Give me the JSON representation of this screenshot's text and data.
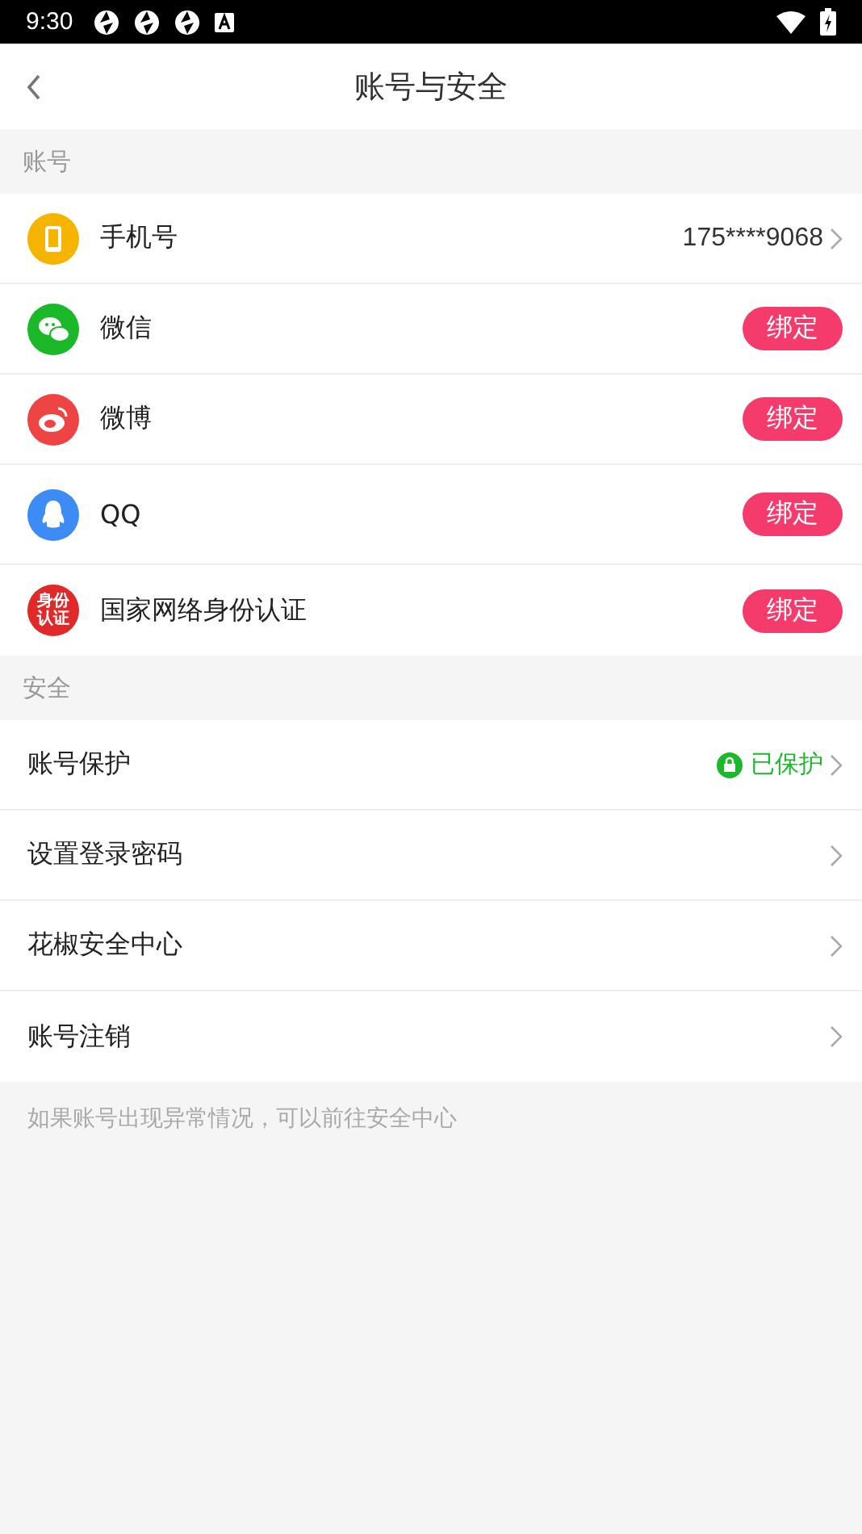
{
  "status_bar": {
    "time": "9:30"
  },
  "header": {
    "title": "账号与安全"
  },
  "sections": [
    {
      "title": "账号",
      "rows": [
        {
          "kind": "phone",
          "label": "手机号",
          "value": "175****9068",
          "chevron": true
        },
        {
          "kind": "wechat",
          "label": "微信",
          "button": "绑定",
          "chevron": false
        },
        {
          "kind": "weibo",
          "label": "微博",
          "button": "绑定",
          "chevron": false
        },
        {
          "kind": "qq",
          "label": "QQ",
          "button": "绑定",
          "chevron": false
        },
        {
          "kind": "idcard",
          "label": "国家网络身份认证",
          "badge_text": [
            "身份",
            "认证"
          ],
          "button": "绑定",
          "chevron": false
        }
      ]
    },
    {
      "title": "安全",
      "rows": [
        {
          "kind": "plain",
          "label": "账号保护",
          "value": "已保护",
          "protected": true,
          "chevron": true
        },
        {
          "kind": "plain",
          "label": "设置登录密码",
          "chevron": true
        },
        {
          "kind": "plain",
          "label": "花椒安全中心",
          "chevron": true
        },
        {
          "kind": "plain",
          "label": "账号注销",
          "chevron": true
        }
      ]
    }
  ],
  "footer_note": "如果账号出现异常情况，可以前往安全中心"
}
